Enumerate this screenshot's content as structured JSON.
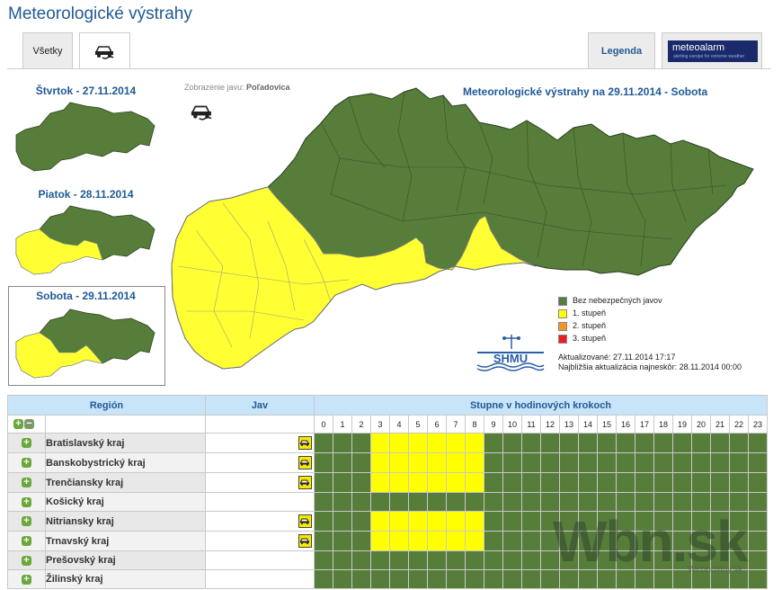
{
  "page": {
    "title": "Meteorologické výstrahy"
  },
  "tabs": {
    "all": "Všetky",
    "legend": "Legenda",
    "meteoalarm": "meteoalarm",
    "meteoalarm_tagline": "alerting europe for extreme weather"
  },
  "days": [
    {
      "label": "Štvrtok - 27.11.2014"
    },
    {
      "label": "Piatok - 28.11.2014"
    },
    {
      "label": "Sobota - 29.11.2014"
    }
  ],
  "display": {
    "label": "Zobrazenie javu:",
    "value": "Poľadovica"
  },
  "map": {
    "title": "Meteorologické výstrahy na 29.11.2014 - Sobota"
  },
  "legend": {
    "items": [
      {
        "label": "Bez nebezpečných javov",
        "color": "#567d3a"
      },
      {
        "label": "1. stupeň",
        "color": "#ffff00"
      },
      {
        "label": "2. stupeň",
        "color": "#f7941d"
      },
      {
        "label": "3. stupeň",
        "color": "#ee1c25"
      }
    ]
  },
  "logo": {
    "text": "SHMÚ"
  },
  "update": {
    "updated": "Aktualizované: 27.11.2014 17:17",
    "next": "Najbližšia aktualizácia najneskôr: 28.11.2014 00:00"
  },
  "table": {
    "headers": {
      "region": "Región",
      "phenomenon": "Jav",
      "steps": "Stupne v hodinových krokoch"
    },
    "hours": [
      "0",
      "1",
      "2",
      "3",
      "4",
      "5",
      "6",
      "7",
      "8",
      "9",
      "10",
      "11",
      "12",
      "13",
      "14",
      "15",
      "16",
      "17",
      "18",
      "19",
      "20",
      "21",
      "22",
      "23"
    ],
    "rows": [
      {
        "name": "Bratislavský kraj",
        "icon": true,
        "levels": [
          0,
          0,
          0,
          1,
          1,
          1,
          1,
          1,
          1,
          0,
          0,
          0,
          0,
          0,
          0,
          0,
          0,
          0,
          0,
          0,
          0,
          0,
          0,
          0
        ]
      },
      {
        "name": "Banskobystrický kraj",
        "icon": true,
        "levels": [
          0,
          0,
          0,
          1,
          1,
          1,
          1,
          1,
          1,
          0,
          0,
          0,
          0,
          0,
          0,
          0,
          0,
          0,
          0,
          0,
          0,
          0,
          0,
          0
        ]
      },
      {
        "name": "Trenčiansky kraj",
        "icon": true,
        "levels": [
          0,
          0,
          0,
          1,
          1,
          1,
          1,
          1,
          1,
          0,
          0,
          0,
          0,
          0,
          0,
          0,
          0,
          0,
          0,
          0,
          0,
          0,
          0,
          0
        ]
      },
      {
        "name": "Košický kraj",
        "icon": false,
        "levels": [
          0,
          0,
          0,
          0,
          0,
          0,
          0,
          0,
          0,
          0,
          0,
          0,
          0,
          0,
          0,
          0,
          0,
          0,
          0,
          0,
          0,
          0,
          0,
          0
        ]
      },
      {
        "name": "Nitriansky kraj",
        "icon": true,
        "levels": [
          0,
          0,
          0,
          1,
          1,
          1,
          1,
          1,
          1,
          0,
          0,
          0,
          0,
          0,
          0,
          0,
          0,
          0,
          0,
          0,
          0,
          0,
          0,
          0
        ]
      },
      {
        "name": "Trnavský kraj",
        "icon": true,
        "levels": [
          0,
          0,
          0,
          1,
          1,
          1,
          1,
          1,
          1,
          0,
          0,
          0,
          0,
          0,
          0,
          0,
          0,
          0,
          0,
          0,
          0,
          0,
          0,
          0
        ]
      },
      {
        "name": "Prešovský kraj",
        "icon": false,
        "levels": [
          0,
          0,
          0,
          0,
          0,
          0,
          0,
          0,
          0,
          0,
          0,
          0,
          0,
          0,
          0,
          0,
          0,
          0,
          0,
          0,
          0,
          0,
          0,
          0
        ]
      },
      {
        "name": "Žilinský kraj",
        "icon": false,
        "levels": [
          0,
          0,
          0,
          0,
          0,
          0,
          0,
          0,
          0,
          0,
          0,
          0,
          0,
          0,
          0,
          0,
          0,
          0,
          0,
          0,
          0,
          0,
          0,
          0
        ]
      }
    ]
  },
  "watermark": {
    "main": "Wbn.sk",
    "sub": "Webnoviny.sk"
  }
}
